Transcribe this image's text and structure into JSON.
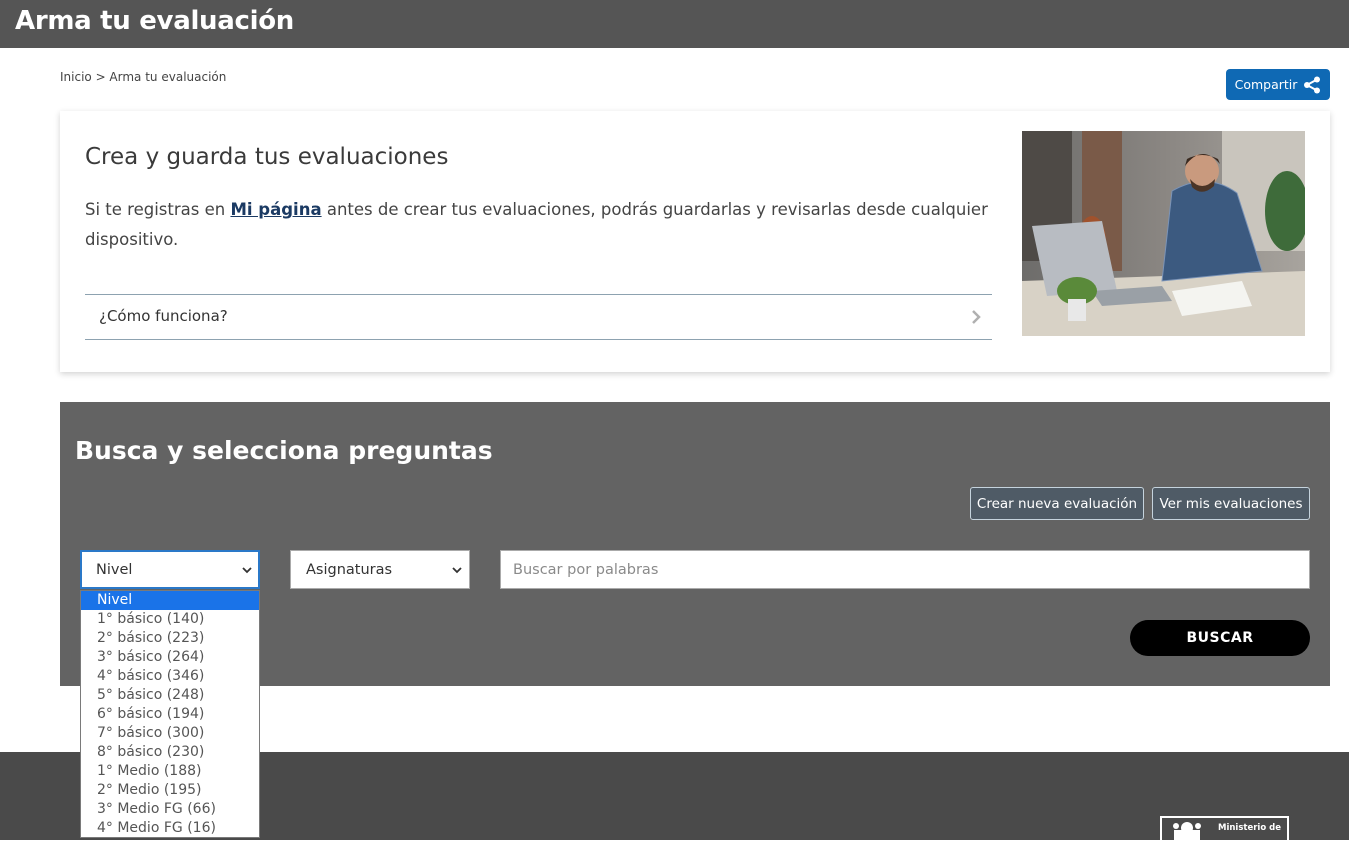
{
  "header": {
    "title": "Arma tu evaluación"
  },
  "breadcrumb": {
    "text": "Inicio > Arma tu evaluación"
  },
  "share": {
    "label": "Compartir",
    "icon": "share-icon"
  },
  "intro": {
    "title": "Crea y guarda tus evaluaciones",
    "text_before": "Si te registras en ",
    "link": "Mi página",
    "text_after": " antes de crear tus evaluaciones, podrás guardarlas y revisarlas desde cualquier dispositivo.",
    "accordion_label": "¿Cómo funciona?"
  },
  "search": {
    "title": "Busca y selecciona preguntas",
    "create_button": "Crear nueva evaluación",
    "my_evals_button": "Ver mis evaluaciones",
    "level_select": "Nivel",
    "subject_select": "Asignaturas",
    "keyword_placeholder": "Buscar por palabras",
    "search_button": "BUSCAR"
  },
  "level_options": [
    "Nivel",
    "1° básico (140)",
    "2° básico (223)",
    "3° básico (264)",
    "4° básico (346)",
    "5° básico (248)",
    "6° básico (194)",
    "7° básico (300)",
    "8° básico (230)",
    "1° Medio (188)",
    "2° Medio (195)",
    "3° Medio FG (66)",
    "4° Medio FG (16)"
  ],
  "footer": {
    "logo_text": "Ministerio de"
  },
  "colors": {
    "header_bg": "#555555",
    "share_blue": "#0f69b4",
    "panel_bg": "#636363",
    "selected_option": "#1a73e8"
  }
}
